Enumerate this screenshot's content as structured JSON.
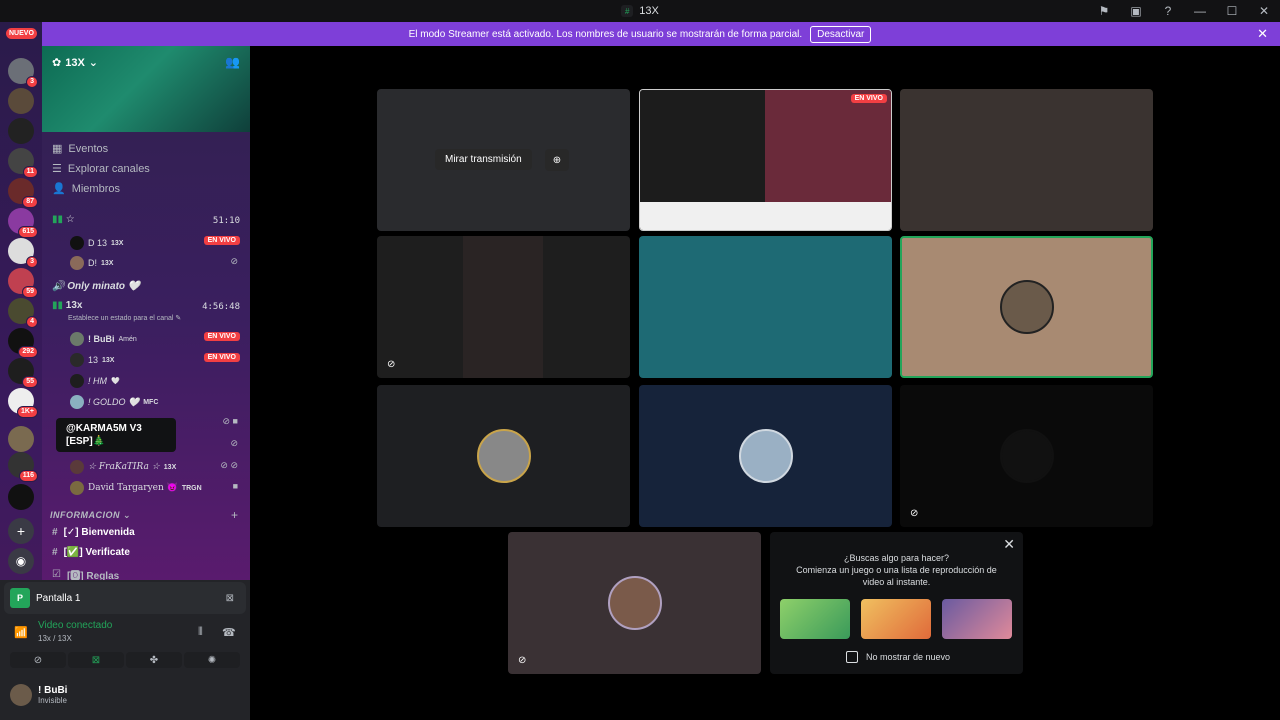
{
  "window": {
    "title": "13X"
  },
  "banner": {
    "text": "El modo Streamer está activado. Los nombres de usuario se mostrarán de forma parcial.",
    "button": "Desactivar"
  },
  "guilds": {
    "new_label": "NUEVO",
    "badges": [
      "3",
      "11",
      "87",
      "615",
      "3",
      "59",
      "4",
      "292",
      "55",
      "1K+",
      "",
      "116"
    ]
  },
  "server": {
    "name": "13X"
  },
  "nav": {
    "events": "Eventos",
    "explore": "Explorar canales",
    "members": "Miembros"
  },
  "voice1": {
    "name": "☆",
    "time": "51:10",
    "members": [
      {
        "name": "D 13",
        "tag": "13X",
        "live": "EN VIVO"
      },
      {
        "name": "D!",
        "tag": "13X"
      }
    ]
  },
  "voice2": {
    "name": "Only minato 🤍"
  },
  "voice3": {
    "name": "13x",
    "time": "4:56:48",
    "status": "Establece un estado para el canal",
    "members": [
      {
        "name": "! BuBi",
        "tag": "Amén",
        "live": "EN VIVO"
      },
      {
        "name": "13",
        "tag": "13X",
        "live": "EN VIVO"
      },
      {
        "name": "! HM",
        "tag": "🤍"
      },
      {
        "name": "! GOLDO 🤍",
        "tag": "MFC"
      },
      {
        "name": "☆ FraKaTIRa ☆",
        "tag": "13X"
      },
      {
        "name": "David Targaryen 😈",
        "tag": "TRGN"
      }
    ]
  },
  "tooltip": {
    "text": "@KARMA5M V3 [ESP]🎄"
  },
  "category": {
    "label": "INFORMACION"
  },
  "channels": [
    {
      "label": "[✓] Bienvenida"
    },
    {
      "label": "[✅] Verificate"
    },
    {
      "label": "[🅾] Reglas"
    }
  ],
  "voicepanel": {
    "screen": "Pantalla 1",
    "connected": "Video conectado",
    "sub": "13x / 13X"
  },
  "user": {
    "name": "! BuBi",
    "status": "Invisible"
  },
  "stage": {
    "watch": "Mirar transmisión",
    "live": "EN VIVO"
  },
  "activity": {
    "line1": "¿Buscas algo para hacer?",
    "line2": "Comienza un juego o una lista de reproducción de video al instante.",
    "dont_show": "No mostrar de nuevo"
  },
  "colors": {
    "accent": "#7e3fd8",
    "live": "#f23f43",
    "green": "#23a55a"
  }
}
